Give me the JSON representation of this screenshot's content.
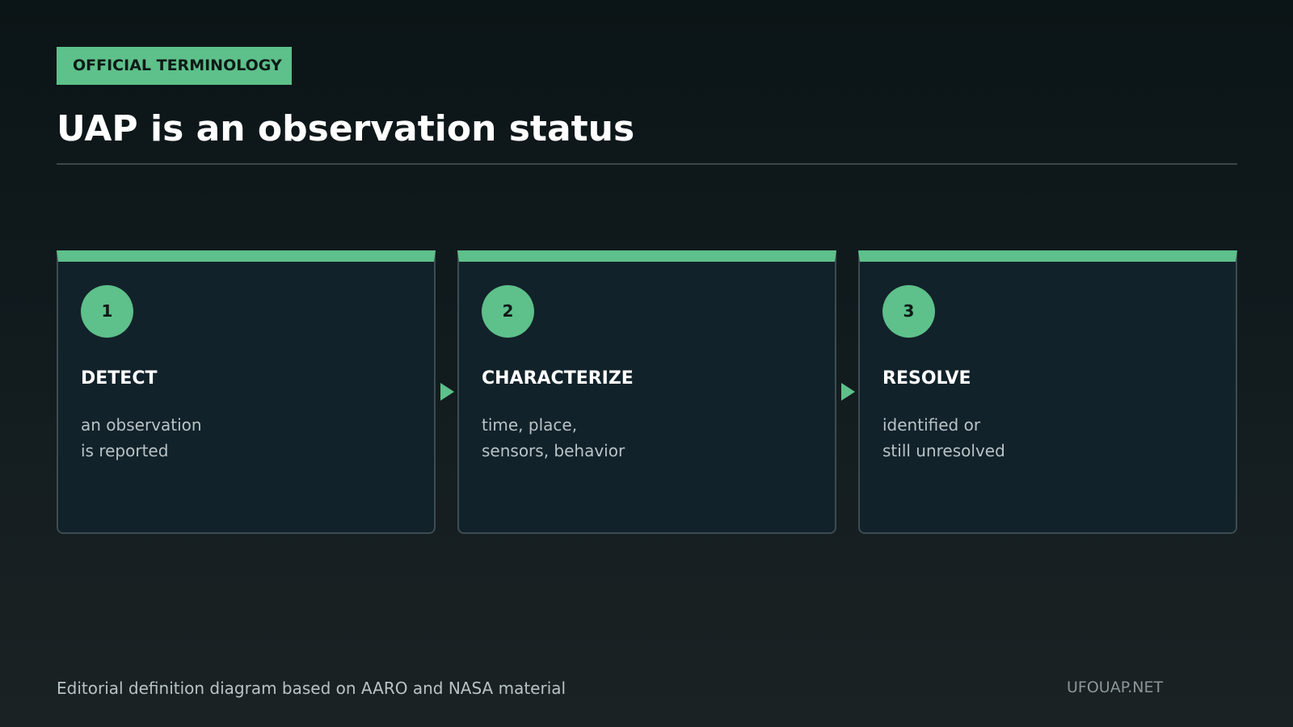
{
  "badge": "OFFICIAL TERMINOLOGY",
  "title": "UAP is an observation status",
  "steps": [
    {
      "number": "1",
      "title": "DETECT",
      "lines": [
        "an observation",
        "is reported"
      ]
    },
    {
      "number": "2",
      "title": "CHARACTERIZE",
      "lines": [
        "time, place,",
        "sensors, behavior"
      ]
    },
    {
      "number": "3",
      "title": "RESOLVE",
      "lines": [
        "identified or",
        "still unresolved"
      ]
    }
  ],
  "footer": {
    "source": "Editorial definition diagram based on AARO and NASA material",
    "brand": "UFOUAP.NET"
  },
  "colors": {
    "accent": "#5ec08a",
    "card_background": "#12222a",
    "card_border": "#3d4c51"
  }
}
